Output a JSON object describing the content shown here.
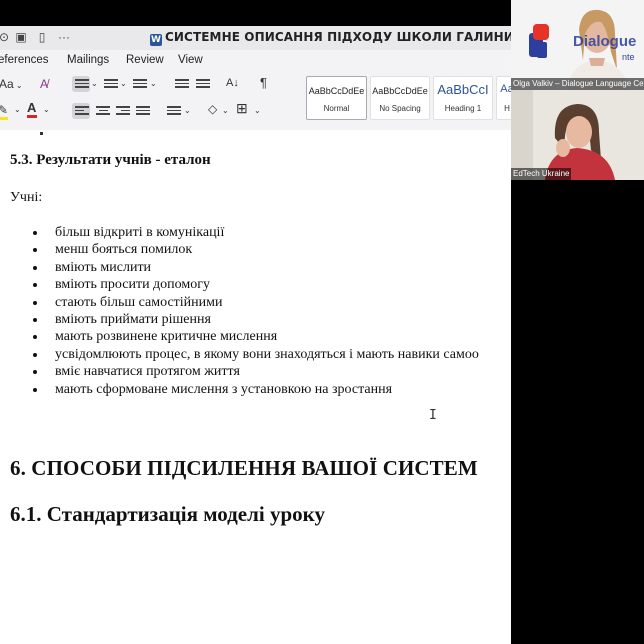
{
  "word": {
    "title": "СИСТЕМНЕ ОПИСАННЯ ПІДХОДУ ШКОЛИ ГАЛИНИ",
    "tabs": [
      "eferences",
      "Mailings",
      "Review",
      "View"
    ],
    "font_size_label": "Aa",
    "styles": [
      {
        "sample": "AaBbCcDdEe",
        "name": "Normal",
        "active": true
      },
      {
        "sample": "AaBbCcDdEe",
        "name": "No Spacing",
        "active": false
      },
      {
        "sample": "AaBbCcI",
        "name": "Heading 1",
        "active": false
      },
      {
        "sample": "Aa",
        "name": "H",
        "active": false
      }
    ],
    "colors": {
      "highlight": "#f5e61c",
      "font_color": "#d7242a",
      "word_blue": "#2b579a"
    }
  },
  "document": {
    "heading_5_3": "5.3. Результати учнів - еталон",
    "students_label": "Учні:",
    "bullets": [
      "більш відкриті в комунікації",
      "менш бояться помилок",
      "вміють мислити",
      "вміють просити допомогу",
      "стають більш самостійними",
      "вміють приймати рішення",
      "мають розвинене критичне мислення",
      "усвідомлюють процес, в якому вони знаходяться і мають навики самоо",
      "вміє навчатися протягом життя",
      "мають сформоване мислення з установкою на зростання"
    ],
    "heading_6": "6. СПОСОБИ ПІДСИЛЕННЯ ВАШОЇ СИСТЕМ",
    "heading_6_1": "6.1. Стандартизація моделі уроку"
  },
  "video": {
    "participants": [
      {
        "name": "Olga Valkiv – Dialogue Language Ce",
        "logo_text": "Dialogue",
        "logo_sub": "nte"
      },
      {
        "name": "EdTech Ukraine"
      }
    ]
  }
}
